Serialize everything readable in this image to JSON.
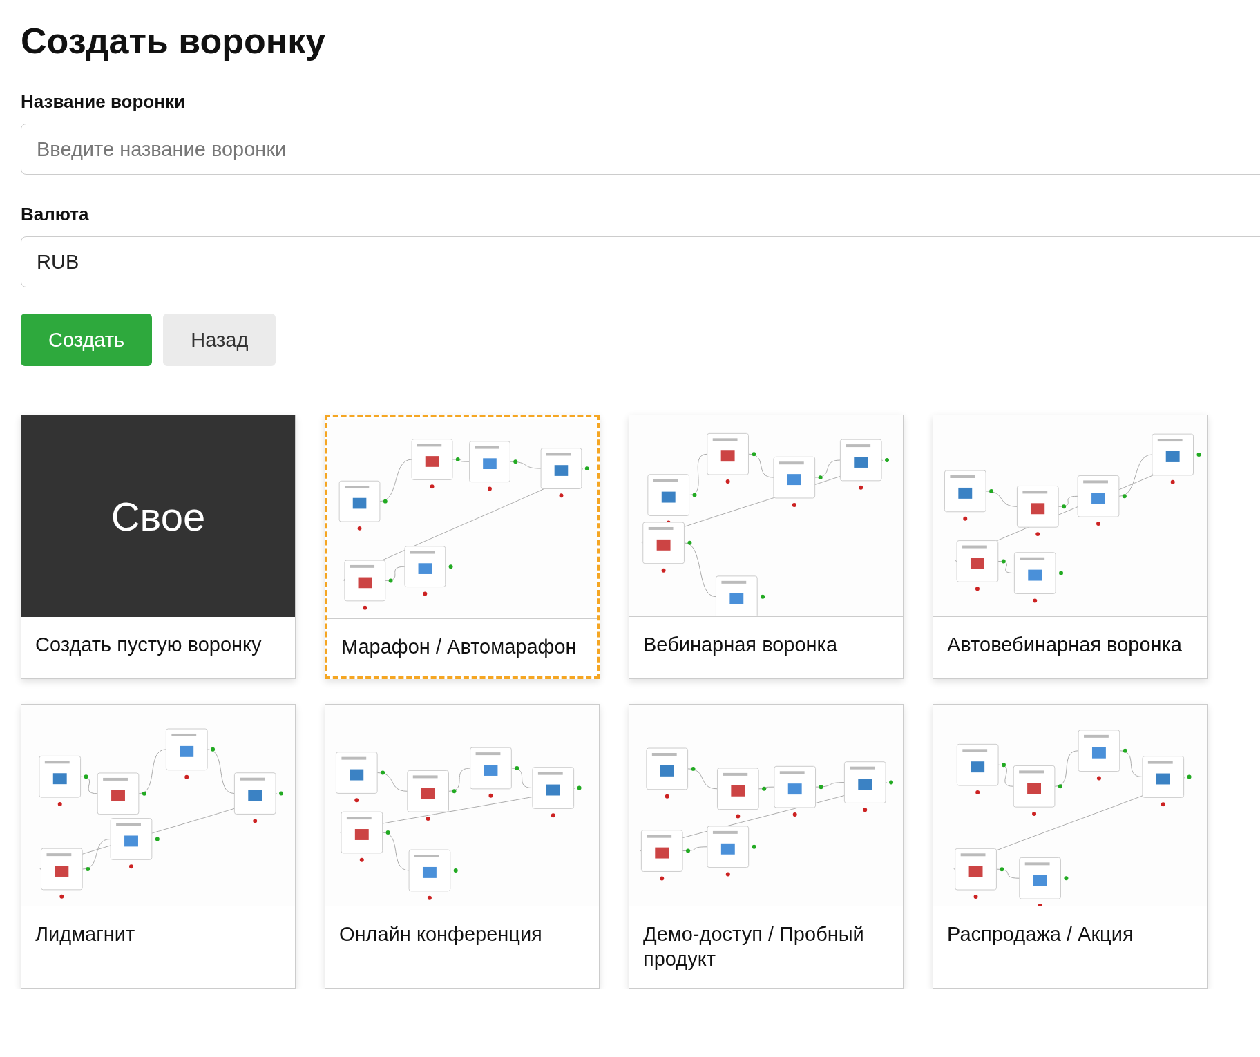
{
  "title": "Создать воронку",
  "fields": [
    {
      "label": "Название воронки",
      "placeholder": "Введите название воронки"
    },
    {
      "label": "Валюта",
      "value": "RUB"
    }
  ],
  "buttons": [
    {
      "label": "Создать",
      "kind": "primary"
    },
    {
      "label": "Назад",
      "kind": "secondary"
    }
  ],
  "templates": [
    {
      "kind": "blank",
      "cover": "Свое",
      "caption": "Создать пустую воронку",
      "selected": false
    },
    {
      "kind": "template",
      "caption": "Марафон / Автомарафон",
      "selected": true
    },
    {
      "kind": "template",
      "caption": "Вебинарная воронка",
      "selected": false
    },
    {
      "kind": "template",
      "caption": "Автовебинарная воронка",
      "selected": false
    },
    {
      "kind": "template",
      "caption": "Лидмагнит",
      "selected": false
    },
    {
      "kind": "template",
      "caption": "Онлайн конференция",
      "selected": false
    },
    {
      "kind": "template",
      "caption": "Демо-доступ / Пробный продукт",
      "selected": false
    },
    {
      "kind": "template",
      "caption": "Распродажа / Акция",
      "selected": false
    }
  ]
}
